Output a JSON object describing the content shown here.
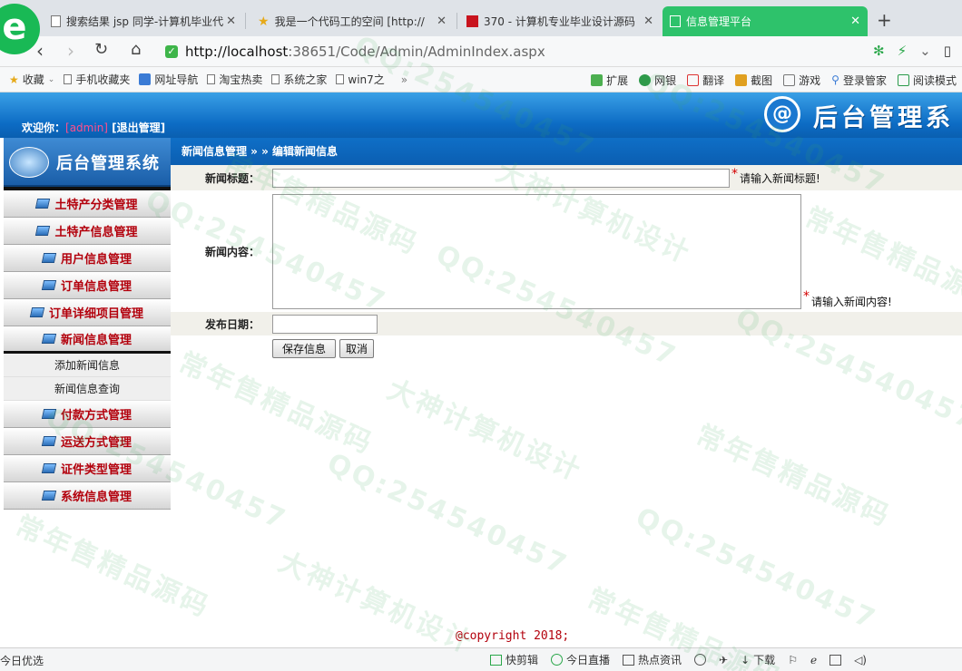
{
  "browser": {
    "tabs": [
      {
        "label": "搜索结果 jsp 同学-计算机毕业代",
        "icon": "document-icon"
      },
      {
        "label": "我是一个代码工的空间 [http://",
        "icon": "star-icon"
      },
      {
        "label": "370 - 计算机专业毕业设计源码",
        "icon": "red-square-icon"
      },
      {
        "label": "信息管理平台",
        "icon": "page-icon",
        "active": true
      }
    ],
    "new_tab": "+",
    "url_host": "http://localhost",
    "url_path": ":38651/Code/Admin/AdminIndex.aspx",
    "bookmarks": [
      "收藏",
      "手机收藏夹",
      "网址导航",
      "淘宝热卖",
      "系统之家",
      "win7之"
    ],
    "toolbar_right": [
      "扩展",
      "网银",
      "翻译",
      "截图",
      "游戏",
      "登录管家",
      "阅读模式"
    ],
    "more": "»"
  },
  "header": {
    "welcome": "欢迎你：",
    "username": "[admin]",
    "logout": "[退出管理]",
    "logo_mark": "@",
    "title": "后台管理系"
  },
  "sidebar": {
    "logo_title": "后台管理系统",
    "menu_before": [
      "土特产分类管理",
      "土特产信息管理",
      "用户信息管理",
      "订单信息管理",
      "订单详细项目管理",
      "新闻信息管理"
    ],
    "submenu": [
      "添加新闻信息",
      "新闻信息查询"
    ],
    "menu_after": [
      "付款方式管理",
      "运送方式管理",
      "证件类型管理",
      "系统信息管理"
    ]
  },
  "breadcrumb": "新闻信息管理 » » 编辑新闻信息",
  "form": {
    "title_label": "新闻标题：",
    "title_value": "",
    "title_hint": "请输入新闻标题!",
    "content_label": "新闻内容：",
    "content_value": "",
    "content_hint": "请输入新闻内容!",
    "date_label": "发布日期：",
    "date_value": "",
    "required_mark": "*",
    "save_button": "保存信息",
    "cancel_button": "取消"
  },
  "footer": {
    "copyright": "@copyright 2018;"
  },
  "statusbar": {
    "left": "今日优选",
    "items": [
      "快剪辑",
      "今日直播",
      "热点资讯",
      "下载"
    ]
  },
  "watermarks": [
    "大神计算机设计",
    "常年售精品源码",
    "QQ:254540457"
  ]
}
